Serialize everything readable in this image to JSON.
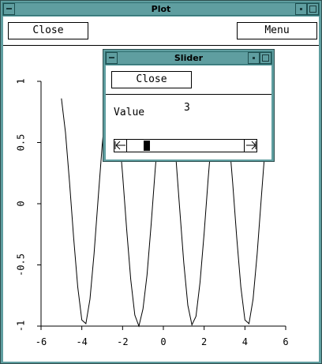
{
  "plot_window": {
    "title": "Plot",
    "close_label": "Close",
    "menu_label": "Menu"
  },
  "slider_window": {
    "title": "Slider",
    "close_label": "Close",
    "value_label": "Value",
    "value": "3",
    "slider_fraction": 0.15
  },
  "chart_data": {
    "type": "line",
    "title": "",
    "xlabel": "",
    "ylabel": "",
    "xlim": [
      -6,
      6
    ],
    "ylim": [
      -1,
      1
    ],
    "x_ticks": [
      "-6",
      "-4",
      "-2",
      "0",
      "2",
      "4",
      "6"
    ],
    "y_ticks": [
      "1",
      "0.5",
      "0",
      "-0.5",
      "-1"
    ],
    "series": [
      {
        "x": [
          -5.0,
          -4.8,
          -4.6,
          -4.4,
          -4.2,
          -4.0,
          -3.8,
          -3.6,
          -3.4,
          -3.2,
          -3.0,
          -2.8,
          -2.6,
          -2.4,
          -2.2,
          -2.0,
          -1.8,
          -1.6,
          -1.4,
          -1.2,
          -1.0,
          -0.8,
          -0.6,
          -0.4,
          -0.2,
          0.0,
          0.2,
          0.4,
          0.6,
          0.8,
          1.0,
          1.2,
          1.4,
          1.6,
          1.8,
          2.0,
          2.2,
          2.4,
          2.6,
          2.8,
          3.0,
          3.2,
          3.4,
          3.6,
          3.8,
          4.0,
          4.2,
          4.4,
          4.6,
          4.8,
          5.0
        ],
        "y": [
          0.86,
          0.58,
          0.17,
          -0.28,
          -0.68,
          -0.95,
          -0.98,
          -0.78,
          -0.41,
          0.04,
          0.48,
          0.83,
          0.99,
          0.92,
          0.64,
          0.24,
          -0.21,
          -0.62,
          -0.91,
          -1.0,
          -0.86,
          -0.58,
          -0.17,
          0.28,
          0.68,
          0.95,
          0.98,
          0.78,
          0.41,
          -0.04,
          -0.48,
          -0.83,
          -0.99,
          -0.92,
          -0.64,
          -0.24,
          0.21,
          0.62,
          0.91,
          1.0,
          0.86,
          0.58,
          0.17,
          -0.28,
          -0.68,
          -0.95,
          -0.98,
          -0.78,
          -0.41,
          0.04,
          0.48
        ]
      }
    ]
  }
}
